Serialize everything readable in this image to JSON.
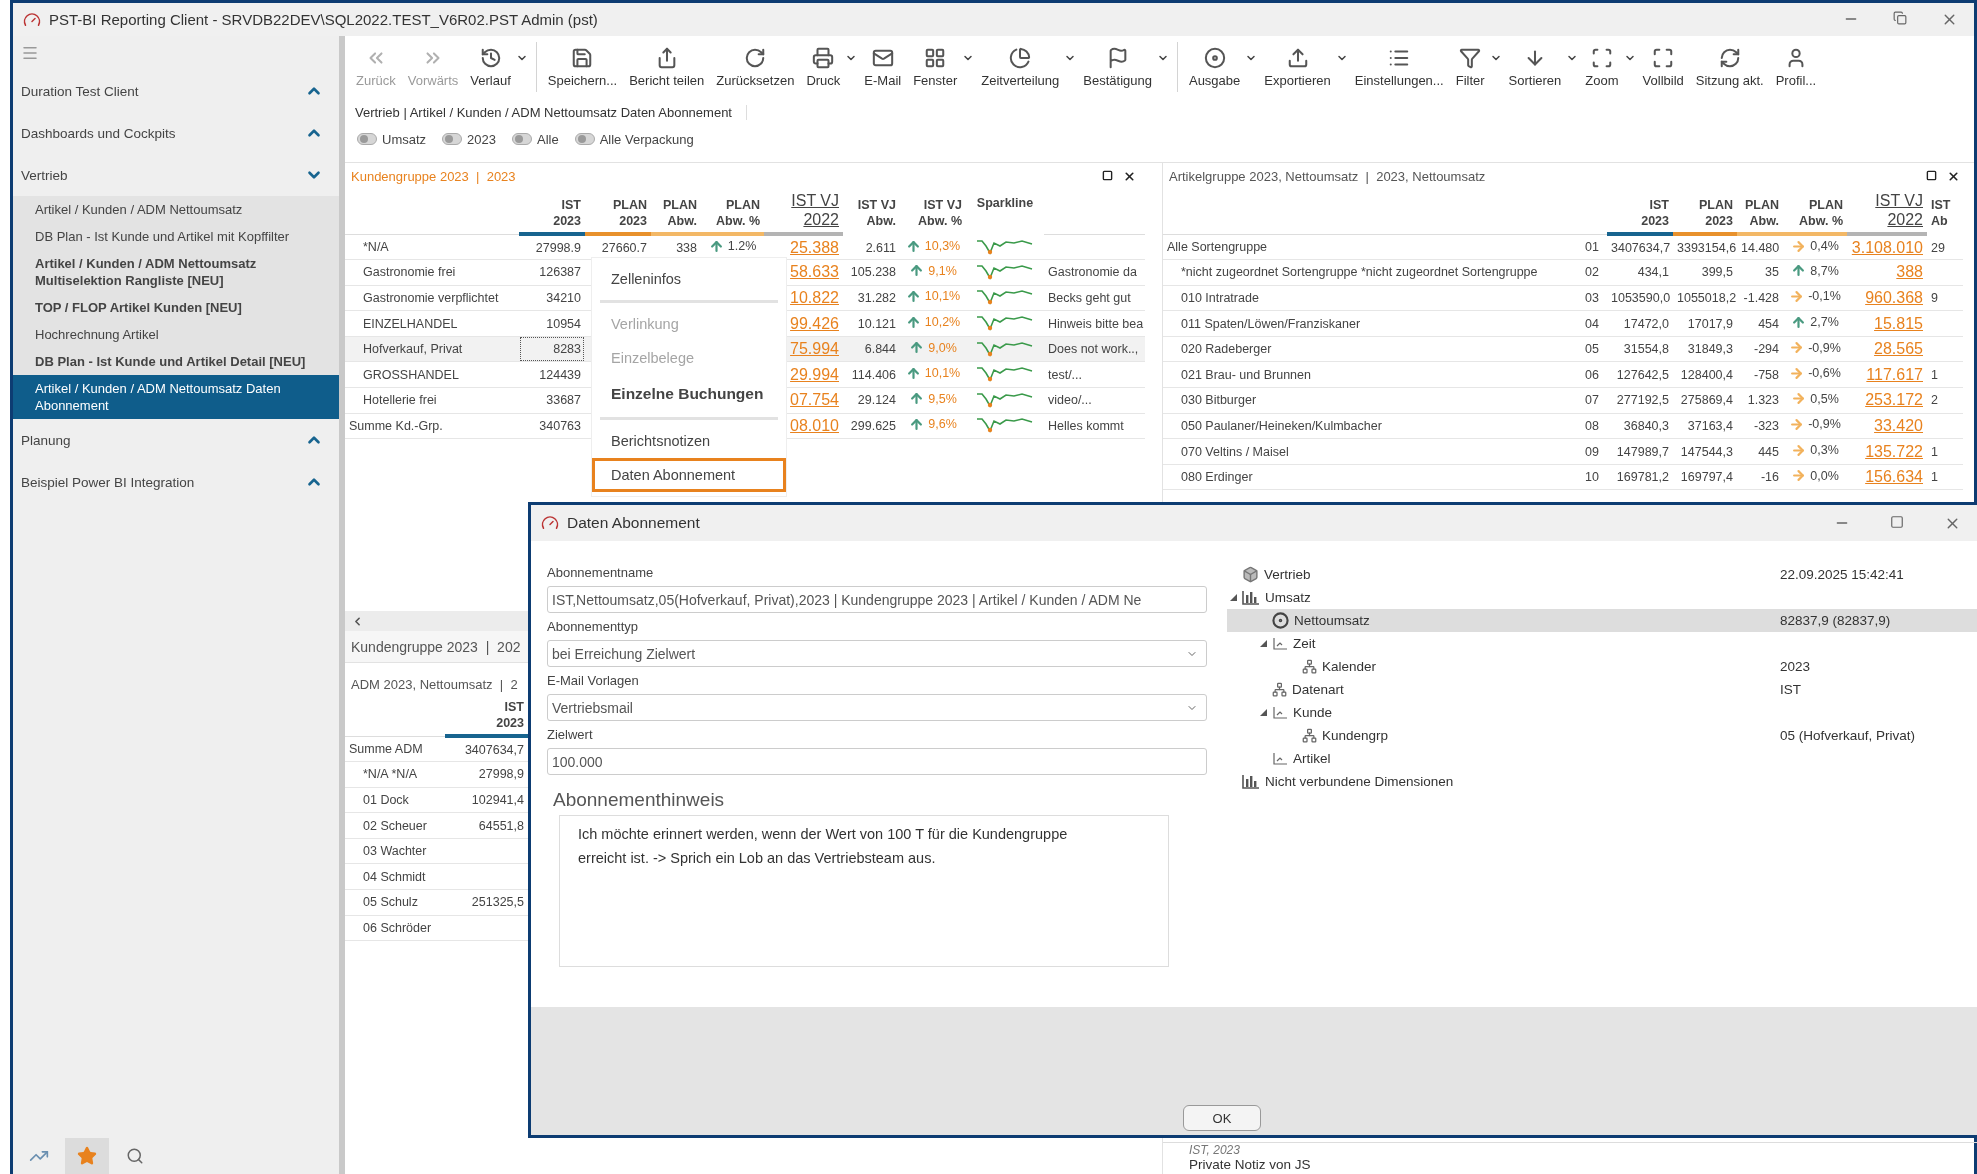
{
  "window": {
    "title": "PST-BI Reporting Client - SRVDB22DEV\\SQL2022.TEST_V6R02.PST Admin (pst)"
  },
  "sidebar": {
    "groups": [
      {
        "label": "Duration Test Client",
        "expanded": false
      },
      {
        "label": "Dashboards und Cockpits",
        "expanded": false
      },
      {
        "label": "Vertrieb",
        "expanded": true,
        "items": [
          {
            "label": "Artikel / Kunden / ADM Nettoumsatz",
            "emphasized": false,
            "selected": false
          },
          {
            "label": "DB Plan - Ist  Kunde und Artikel mit Kopffilter",
            "emphasized": false,
            "selected": false
          },
          {
            "label": "Artikel / Kunden / ADM Nettoumsatz Multiselektion Rangliste [NEU]",
            "emphasized": true,
            "selected": false
          },
          {
            "label": "TOP / FLOP Artikel Kunden [NEU]",
            "emphasized": true,
            "selected": false
          },
          {
            "label": "Hochrechnung Artikel",
            "emphasized": false,
            "selected": false
          },
          {
            "label": "DB Plan - Ist  Kunde und Artikel Detail [NEU]",
            "emphasized": true,
            "selected": false
          },
          {
            "label": "Artikel / Kunden / ADM Nettoumsatz Daten Abonnement",
            "emphasized": false,
            "selected": true
          }
        ]
      },
      {
        "label": "Planung",
        "expanded": false
      },
      {
        "label": "Beispiel Power BI Integration",
        "expanded": false
      }
    ],
    "footer_tabs": [
      {
        "selected": false
      },
      {
        "selected": true
      },
      {
        "selected": false
      }
    ]
  },
  "toolbar": {
    "items": [
      {
        "label": "Zurück",
        "disabled": true,
        "dropdown": false,
        "separator_before": false
      },
      {
        "label": "Vorwärts",
        "disabled": true,
        "dropdown": false,
        "separator_before": false
      },
      {
        "label": "Verlauf",
        "disabled": false,
        "dropdown": true,
        "separator_before": false
      },
      {
        "label": "Speichern...",
        "disabled": false,
        "dropdown": false,
        "separator_before": true
      },
      {
        "label": "Bericht teilen",
        "disabled": false,
        "dropdown": false,
        "separator_before": false
      },
      {
        "label": "Zurücksetzen",
        "disabled": false,
        "dropdown": false,
        "separator_before": false
      },
      {
        "label": "Druck",
        "disabled": false,
        "dropdown": true,
        "separator_before": false
      },
      {
        "label": "E-Mail",
        "disabled": false,
        "dropdown": false,
        "separator_before": false
      },
      {
        "label": "Fenster",
        "disabled": false,
        "dropdown": true,
        "separator_before": false
      },
      {
        "label": "Zeitverteilung",
        "disabled": false,
        "dropdown": true,
        "separator_before": false
      },
      {
        "label": "Bestätigung",
        "disabled": false,
        "dropdown": true,
        "separator_before": false
      },
      {
        "label": "Ausgabe",
        "disabled": false,
        "dropdown": true,
        "separator_before": true
      },
      {
        "label": "Exportieren",
        "disabled": false,
        "dropdown": true,
        "separator_before": false
      },
      {
        "label": "Einstellungen...",
        "disabled": false,
        "dropdown": false,
        "separator_before": false
      },
      {
        "label": "Filter",
        "disabled": false,
        "dropdown": true,
        "separator_before": false
      },
      {
        "label": "Sortieren",
        "disabled": false,
        "dropdown": true,
        "separator_before": false
      },
      {
        "label": "Zoom",
        "disabled": false,
        "dropdown": true,
        "separator_before": false
      },
      {
        "label": "Vollbild",
        "disabled": false,
        "dropdown": false,
        "separator_before": false
      },
      {
        "label": "Sitzung akt.",
        "disabled": false,
        "dropdown": false,
        "separator_before": false
      },
      {
        "label": "Profil...",
        "disabled": false,
        "dropdown": false,
        "separator_before": false
      }
    ]
  },
  "breadcrumb": "Vertrieb | Artikel / Kunden / ADM Nettoumsatz Daten Abonnement",
  "filters": [
    "Umsatz",
    "2023",
    "Alle",
    "Alle Verpackung"
  ],
  "customer_panel": {
    "title": "Kundengruppe 2023  |  2023",
    "columns": [
      {
        "label": "IST\n2023",
        "color": "#17648f"
      },
      {
        "label": "PLAN\n2023",
        "color": "#e8912c"
      },
      {
        "label": "PLAN\nAbw.",
        "color": "#f3b866"
      },
      {
        "label": "PLAN\nAbw. %",
        "color": "#f3b866"
      },
      {
        "label": "IST VJ\n2022",
        "color": "#b4b4b4"
      },
      {
        "label": "IST VJ\nAbw.",
        "color": "#ffffff"
      },
      {
        "label": "IST VJ\nAbw. %",
        "color": "#ffffff"
      },
      {
        "label": "Sparkline",
        "color": "#ffffff"
      }
    ],
    "rows": [
      {
        "label": "*N/A",
        "kind": "member",
        "selected": false,
        "ist": "27998.9",
        "plan": "27660.7",
        "plan_abw": "338",
        "plan_pct": {
          "kind": "up",
          "text": "1.2%"
        },
        "vj": "25.388",
        "vj_abw": "2.611",
        "vj_pct": {
          "kind": "up",
          "text": "10,3%"
        }
      },
      {
        "label": "Gastronomie frei",
        "kind": "member",
        "selected": false,
        "ist": "126387",
        "vj": "58.633",
        "vj_abw": "105.238",
        "vj_pct": {
          "kind": "up",
          "text": "9,1%"
        },
        "note": "Gastronomie da"
      },
      {
        "label": "Gastronomie verpflichtet",
        "kind": "member",
        "selected": false,
        "ist": "34210",
        "vj": "10.822",
        "vj_abw": "31.282",
        "vj_pct": {
          "kind": "up",
          "text": "10,1%"
        },
        "note": "Becks geht gut"
      },
      {
        "label": "EINZELHANDEL",
        "kind": "member",
        "selected": false,
        "ist": "10954",
        "vj": "99.426",
        "vj_abw": "10.121",
        "vj_pct": {
          "kind": "up",
          "text": "10,2%"
        },
        "note": "Hinweis bitte bea"
      },
      {
        "label": "Hofverkauf, Privat",
        "kind": "member",
        "selected": true,
        "ist": "8283",
        "vj": "75.994",
        "vj_abw": "6.844",
        "vj_pct": {
          "kind": "up",
          "text": "9,0%"
        },
        "note": "Does not work..,"
      },
      {
        "label": "GROSSHANDEL",
        "kind": "member",
        "selected": false,
        "ist": "124439",
        "vj": "29.994",
        "vj_abw": "114.406",
        "vj_pct": {
          "kind": "up",
          "text": "10,1%"
        },
        "note": "test/..."
      },
      {
        "label": "Hotellerie frei",
        "kind": "member",
        "selected": false,
        "ist": "33687",
        "vj": "07.754",
        "vj_abw": "29.124",
        "vj_pct": {
          "kind": "up",
          "text": "9,5%"
        },
        "note": "video/..."
      },
      {
        "label": "Summe Kd.-Grp.",
        "kind": "total",
        "selected": false,
        "ist": "340763",
        "vj": "08.010",
        "vj_abw": "299.625",
        "vj_pct": {
          "kind": "up",
          "text": "9,6%"
        },
        "note": "Helles kommt"
      }
    ]
  },
  "context_menu": {
    "groups": [
      [
        {
          "label": "Zelleninfos",
          "disabled": false,
          "emphasized": false,
          "selected": false
        }
      ],
      [
        {
          "label": "Verlinkung",
          "disabled": true,
          "emphasized": false,
          "selected": false
        },
        {
          "label": "Einzelbelege",
          "disabled": true,
          "emphasized": false,
          "selected": false
        },
        {
          "label": "Einzelne Buchungen",
          "disabled": false,
          "emphasized": true,
          "selected": false
        }
      ],
      [
        {
          "label": "Berichtsnotizen",
          "disabled": false,
          "emphasized": false,
          "selected": false
        },
        {
          "label": "Daten Abonnement",
          "disabled": false,
          "emphasized": false,
          "selected": true
        }
      ]
    ]
  },
  "article_panel": {
    "title": "Artikelgruppe 2023, Nettoumsatz  |  2023, Nettoumsatz",
    "columns": [
      {
        "label": "IST\n2023",
        "color": "#17648f"
      },
      {
        "label": "PLAN\n2023",
        "color": "#e8912c"
      },
      {
        "label": "PLAN\nAbw.",
        "color": "#f3b866"
      },
      {
        "label": "PLAN\nAbw. %",
        "color": "#f3b866"
      },
      {
        "label": "IST VJ\n2022",
        "color": "#b4b4b4"
      },
      {
        "label": "IST\nAb",
        "color": "#ffffff"
      }
    ],
    "rows": [
      {
        "label": "Alle Sortengruppe",
        "kind": "total",
        "code": "01",
        "ist": "3407634,7",
        "plan": "3393154,6",
        "plan_abw": "14.480",
        "plan_pct": {
          "kind": "right",
          "text": "0,4%"
        },
        "vj": "3.108.010",
        "vj_abw": "29"
      },
      {
        "label": "*nicht zugeordnet Sortengruppe *nicht zugeordnet Sortengruppe",
        "kind": "member",
        "code": "02",
        "ist": "434,1",
        "plan": "399,5",
        "plan_abw": "35",
        "plan_pct": {
          "kind": "up",
          "text": "8,7%"
        },
        "vj": "388"
      },
      {
        "label": "010 Intratrade",
        "kind": "member",
        "code": "03",
        "ist": "1053590,0",
        "plan": "1055018,2",
        "plan_abw": "-1.428",
        "plan_pct": {
          "kind": "right",
          "text": "-0,1%"
        },
        "vj": "960.368",
        "vj_abw": "9"
      },
      {
        "label": "011 Spaten/Löwen/Franziskaner",
        "kind": "member",
        "code": "04",
        "ist": "17472,0",
        "plan": "17017,9",
        "plan_abw": "454",
        "plan_pct": {
          "kind": "up",
          "text": "2,7%"
        },
        "vj": "15.815"
      },
      {
        "label": "020 Radeberger",
        "kind": "member",
        "code": "05",
        "ist": "31554,8",
        "plan": "31849,3",
        "plan_abw": "-294",
        "plan_pct": {
          "kind": "right",
          "text": "-0,9%"
        },
        "vj": "28.565"
      },
      {
        "label": "021 Brau- und Brunnen",
        "kind": "member",
        "code": "06",
        "ist": "127642,5",
        "plan": "128400,4",
        "plan_abw": "-758",
        "plan_pct": {
          "kind": "right",
          "text": "-0,6%"
        },
        "vj": "117.617",
        "vj_abw": "1"
      },
      {
        "label": "030 Bitburger",
        "kind": "member",
        "code": "07",
        "ist": "277192,5",
        "plan": "275869,4",
        "plan_abw": "1.323",
        "plan_pct": {
          "kind": "right",
          "text": "0,5%"
        },
        "vj": "253.172",
        "vj_abw": "2"
      },
      {
        "label": "050 Paulaner/Heineken/Kulmbacher",
        "kind": "member",
        "code": "08",
        "ist": "36840,3",
        "plan": "37163,4",
        "plan_abw": "-323",
        "plan_pct": {
          "kind": "right",
          "text": "-0,9%"
        },
        "vj": "33.420"
      },
      {
        "label": "070 Veltins / Maisel",
        "kind": "member",
        "code": "09",
        "ist": "147989,7",
        "plan": "147544,3",
        "plan_abw": "445",
        "plan_pct": {
          "kind": "right",
          "text": "0,3%"
        },
        "vj": "135.722",
        "vj_abw": "1"
      },
      {
        "label": "080 Erdinger",
        "kind": "member",
        "code": "10",
        "ist": "169781,2",
        "plan": "169797,4",
        "plan_abw": "-16",
        "plan_pct": {
          "kind": "right",
          "text": "0,0%"
        },
        "vj": "156.634",
        "vj_abw": "1"
      }
    ]
  },
  "lower_panel": {
    "title": "Kundengruppe 2023  |  202"
  },
  "adm_panel": {
    "title": "ADM 2023, Nettoumsatz  |  2",
    "column": {
      "label": "IST\n2023",
      "color": "#17648f"
    },
    "rows": [
      {
        "label": "Summe ADM",
        "kind": "total",
        "value": "3407634,7"
      },
      {
        "label": "*N/A *N/A",
        "kind": "member",
        "value": "27998,9"
      },
      {
        "label": "01 Dock",
        "kind": "member",
        "value": "102941,4"
      },
      {
        "label": "02 Scheuer",
        "kind": "member",
        "value": "64551,8"
      },
      {
        "label": "03 Wachter",
        "kind": "member"
      },
      {
        "label": "04 Schmidt",
        "kind": "member"
      },
      {
        "label": "05 Schulz",
        "kind": "member",
        "value": "251325,5"
      },
      {
        "label": "06 Schröder",
        "kind": "member"
      }
    ]
  },
  "dialog": {
    "title": "Daten Abonnement",
    "fields": [
      {
        "label": "Abonnementname",
        "kind": "text",
        "value": "IST,Nettoumsatz,05(Hofverkauf, Privat),2023 | Kundengruppe 2023 | Artikel / Kunden / ADM Ne"
      },
      {
        "label": "Abonnementtyp",
        "kind": "select",
        "value": "bei Erreichung Zielwert"
      },
      {
        "label": "E-Mail Vorlagen",
        "kind": "select",
        "value": "Vertriebsmail"
      },
      {
        "label": "Zielwert",
        "kind": "text",
        "value": "100.000"
      }
    ],
    "note_heading": "Abonnementhinweis",
    "note_text": "Ich möchte erinnert werden, wenn der Wert von 100 T für die Kundengruppe\nerreicht ist. -> Sprich ein Lob an das Vertriebsteam aus.",
    "tree": [
      {
        "label": "Vertrieb",
        "kind": "cube",
        "selected": false,
        "value": "22.09.2025 15:42:41"
      },
      {
        "label": "Umsatz",
        "kind": "measures",
        "selected": false,
        "expanded": true,
        "children": [
          {
            "label": "Nettoumsatz",
            "kind": "measure",
            "selected": true,
            "value": "82837,9 (82837,9)"
          },
          {
            "label": "Zeit",
            "kind": "dimension",
            "selected": false,
            "expanded": true,
            "children": [
              {
                "label": "Kalender",
                "kind": "hierarchy",
                "selected": false,
                "value": "2023"
              }
            ]
          },
          {
            "label": "Datenart",
            "kind": "hierarchy",
            "selected": false,
            "value": "IST"
          },
          {
            "label": "Kunde",
            "kind": "dimension",
            "selected": false,
            "expanded": true,
            "children": [
              {
                "label": "Kundengrp",
                "kind": "hierarchy",
                "selected": false,
                "value": "05 (Hofverkauf, Privat)"
              }
            ]
          },
          {
            "label": "Artikel",
            "kind": "dimension",
            "selected": false
          }
        ]
      },
      {
        "label": "Nicht verbundene Dimensionen",
        "kind": "measures",
        "selected": false
      }
    ],
    "ok_button": "OK"
  },
  "note_panel": {
    "caption": "IST, 2023",
    "text": "Private Notiz von JS"
  }
}
